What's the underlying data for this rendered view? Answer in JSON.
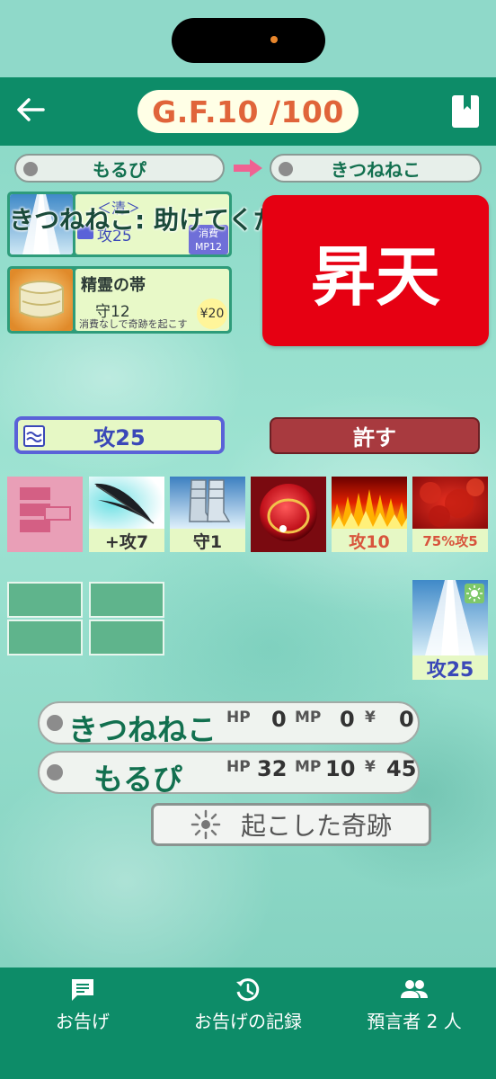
{
  "header": {
    "title": "G.F.10 /100",
    "back_icon": "arrow-left-icon",
    "bookmark_icon": "bookmark-icon"
  },
  "route": {
    "from_player": "もるぴ",
    "to_player": "きつねねこ",
    "arrow_icon": "arrow-right-icon",
    "arrow_color": "#f06292"
  },
  "cards": [
    {
      "tag": "＜清＞",
      "stat": "攻25",
      "cost_label": "消費",
      "cost_value": "MP12"
    },
    {
      "name": "精霊の帯",
      "stat": "守12",
      "description": "消費なしで奇跡を起こす",
      "price": "¥20"
    }
  ],
  "overlay_message": "きつねねこ: 助けてください",
  "big_action": {
    "label": "昇天",
    "color": "#e60012"
  },
  "attack_value": "攻25",
  "forgive_button": "許す",
  "items": [
    {
      "icon": "card-stack-icon",
      "label": ""
    },
    {
      "icon": "black-feather-icon",
      "label": "+攻7"
    },
    {
      "icon": "boots-icon",
      "label": "守1"
    },
    {
      "icon": "red-orb-icon",
      "label": ""
    },
    {
      "icon": "fire-icon",
      "label": "攻10"
    },
    {
      "icon": "red-cloud-icon",
      "label": "75%攻5"
    },
    {
      "icon": "light-beam-icon",
      "label": "攻25"
    }
  ],
  "players": [
    {
      "name": "きつねねこ",
      "hp_label": "HP",
      "hp": "0",
      "mp_label": "MP",
      "mp": "0",
      "yen_label": "¥",
      "yen": "0"
    },
    {
      "name": "もるぴ",
      "hp_label": "HP",
      "hp": "32",
      "mp_label": "MP",
      "mp": "10",
      "yen_label": "¥",
      "yen": "45"
    }
  ],
  "miracle_button": {
    "label": "起こした奇跡",
    "icon": "sparkle-icon"
  },
  "nav": [
    {
      "label": "お告げ",
      "icon": "message-icon"
    },
    {
      "label": "お告げの記録",
      "icon": "history-icon"
    },
    {
      "label": "預言者 2 人",
      "icon": "people-icon"
    }
  ],
  "colors": {
    "header": "#0d8c68",
    "accent_title": "#e0643a",
    "forgive": "#a83a3f"
  }
}
